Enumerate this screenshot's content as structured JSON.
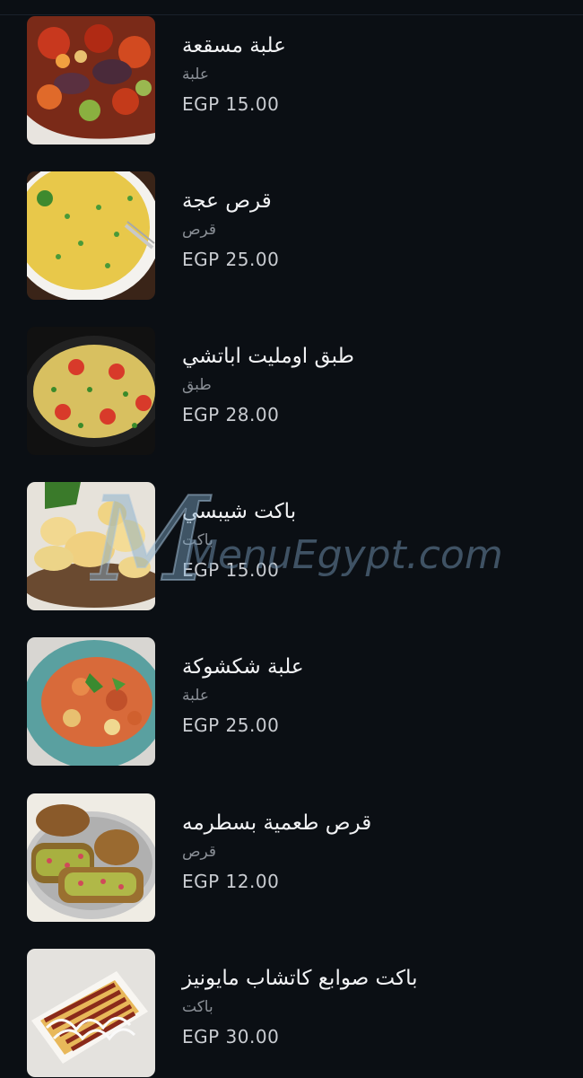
{
  "menu": {
    "items": [
      {
        "name": "علبة مسقعة",
        "unit": "علبة",
        "price": "EGP 15.00",
        "image": "moussaka-tray-photo"
      },
      {
        "name": "قرص عجة",
        "unit": "قرص",
        "price": "EGP 25.00",
        "image": "omelette-disc-photo"
      },
      {
        "name": "طبق اومليت اباتشي",
        "unit": "طبق",
        "price": "EGP 28.00",
        "image": "apache-omelette-pan-photo"
      },
      {
        "name": "باكت شيبسي",
        "unit": "باكت",
        "price": "EGP 15.00",
        "image": "potato-chips-photo"
      },
      {
        "name": "علبة شكشوكة",
        "unit": "علبة",
        "price": "EGP 25.00",
        "image": "shakshuka-plate-photo"
      },
      {
        "name": "قرص طعمية بسطرمه",
        "unit": "قرص",
        "price": "EGP 12.00",
        "image": "falafel-pastrami-photo"
      },
      {
        "name": "باكت صوابع كاتشاب مايونيز",
        "unit": "باكت",
        "price": "EGP 30.00",
        "image": "fries-ketchup-mayo-photo"
      }
    ]
  },
  "watermark": {
    "text": "MenuEgypt.com"
  },
  "colors": {
    "background": "#0b0f14",
    "name_text": "#f2f3f5",
    "unit_text": "#8a8f96",
    "price_text": "#c9ccd1"
  }
}
